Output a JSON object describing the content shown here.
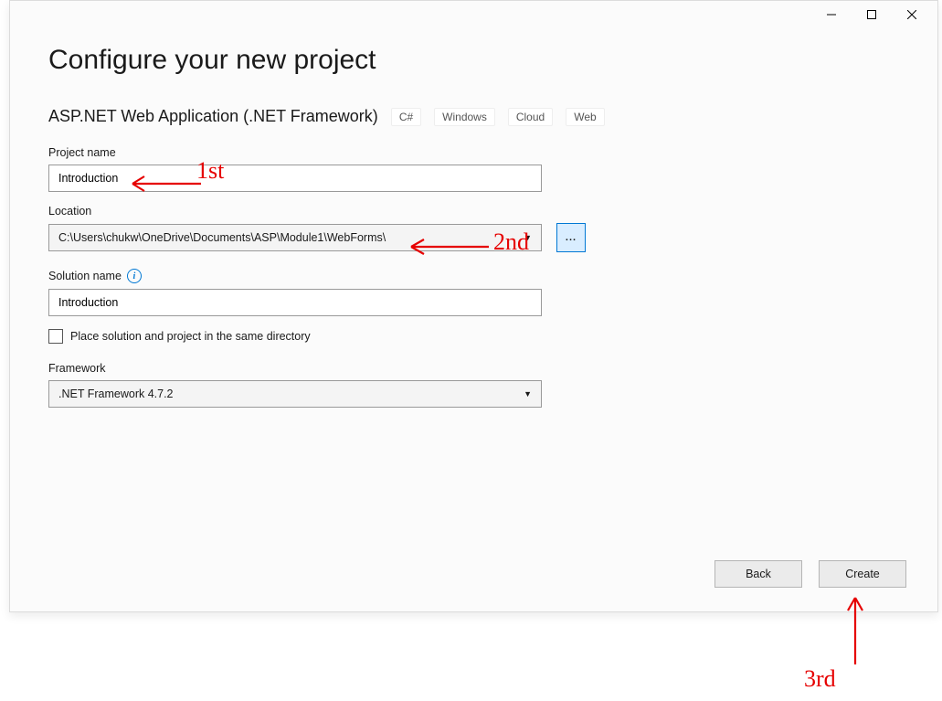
{
  "title": "Configure your new project",
  "subhead": "ASP.NET Web Application (.NET Framework)",
  "tags": [
    "C#",
    "Windows",
    "Cloud",
    "Web"
  ],
  "project_name": {
    "label": "Project name",
    "value": "Introduction"
  },
  "location": {
    "label": "Location",
    "value": "C:\\Users\\chukw\\OneDrive\\Documents\\ASP\\Module1\\WebForms\\"
  },
  "solution": {
    "label": "Solution name",
    "value": "Introduction",
    "info_tooltip": "i"
  },
  "same_dir": {
    "checked": false,
    "label": "Place solution and project in the same directory"
  },
  "framework": {
    "label": "Framework",
    "value": ".NET Framework 4.7.2"
  },
  "buttons": {
    "back": "Back",
    "create": "Create"
  },
  "browse_label": "...",
  "annotations": {
    "first": "1st",
    "second": "2nd",
    "third": "3rd"
  }
}
